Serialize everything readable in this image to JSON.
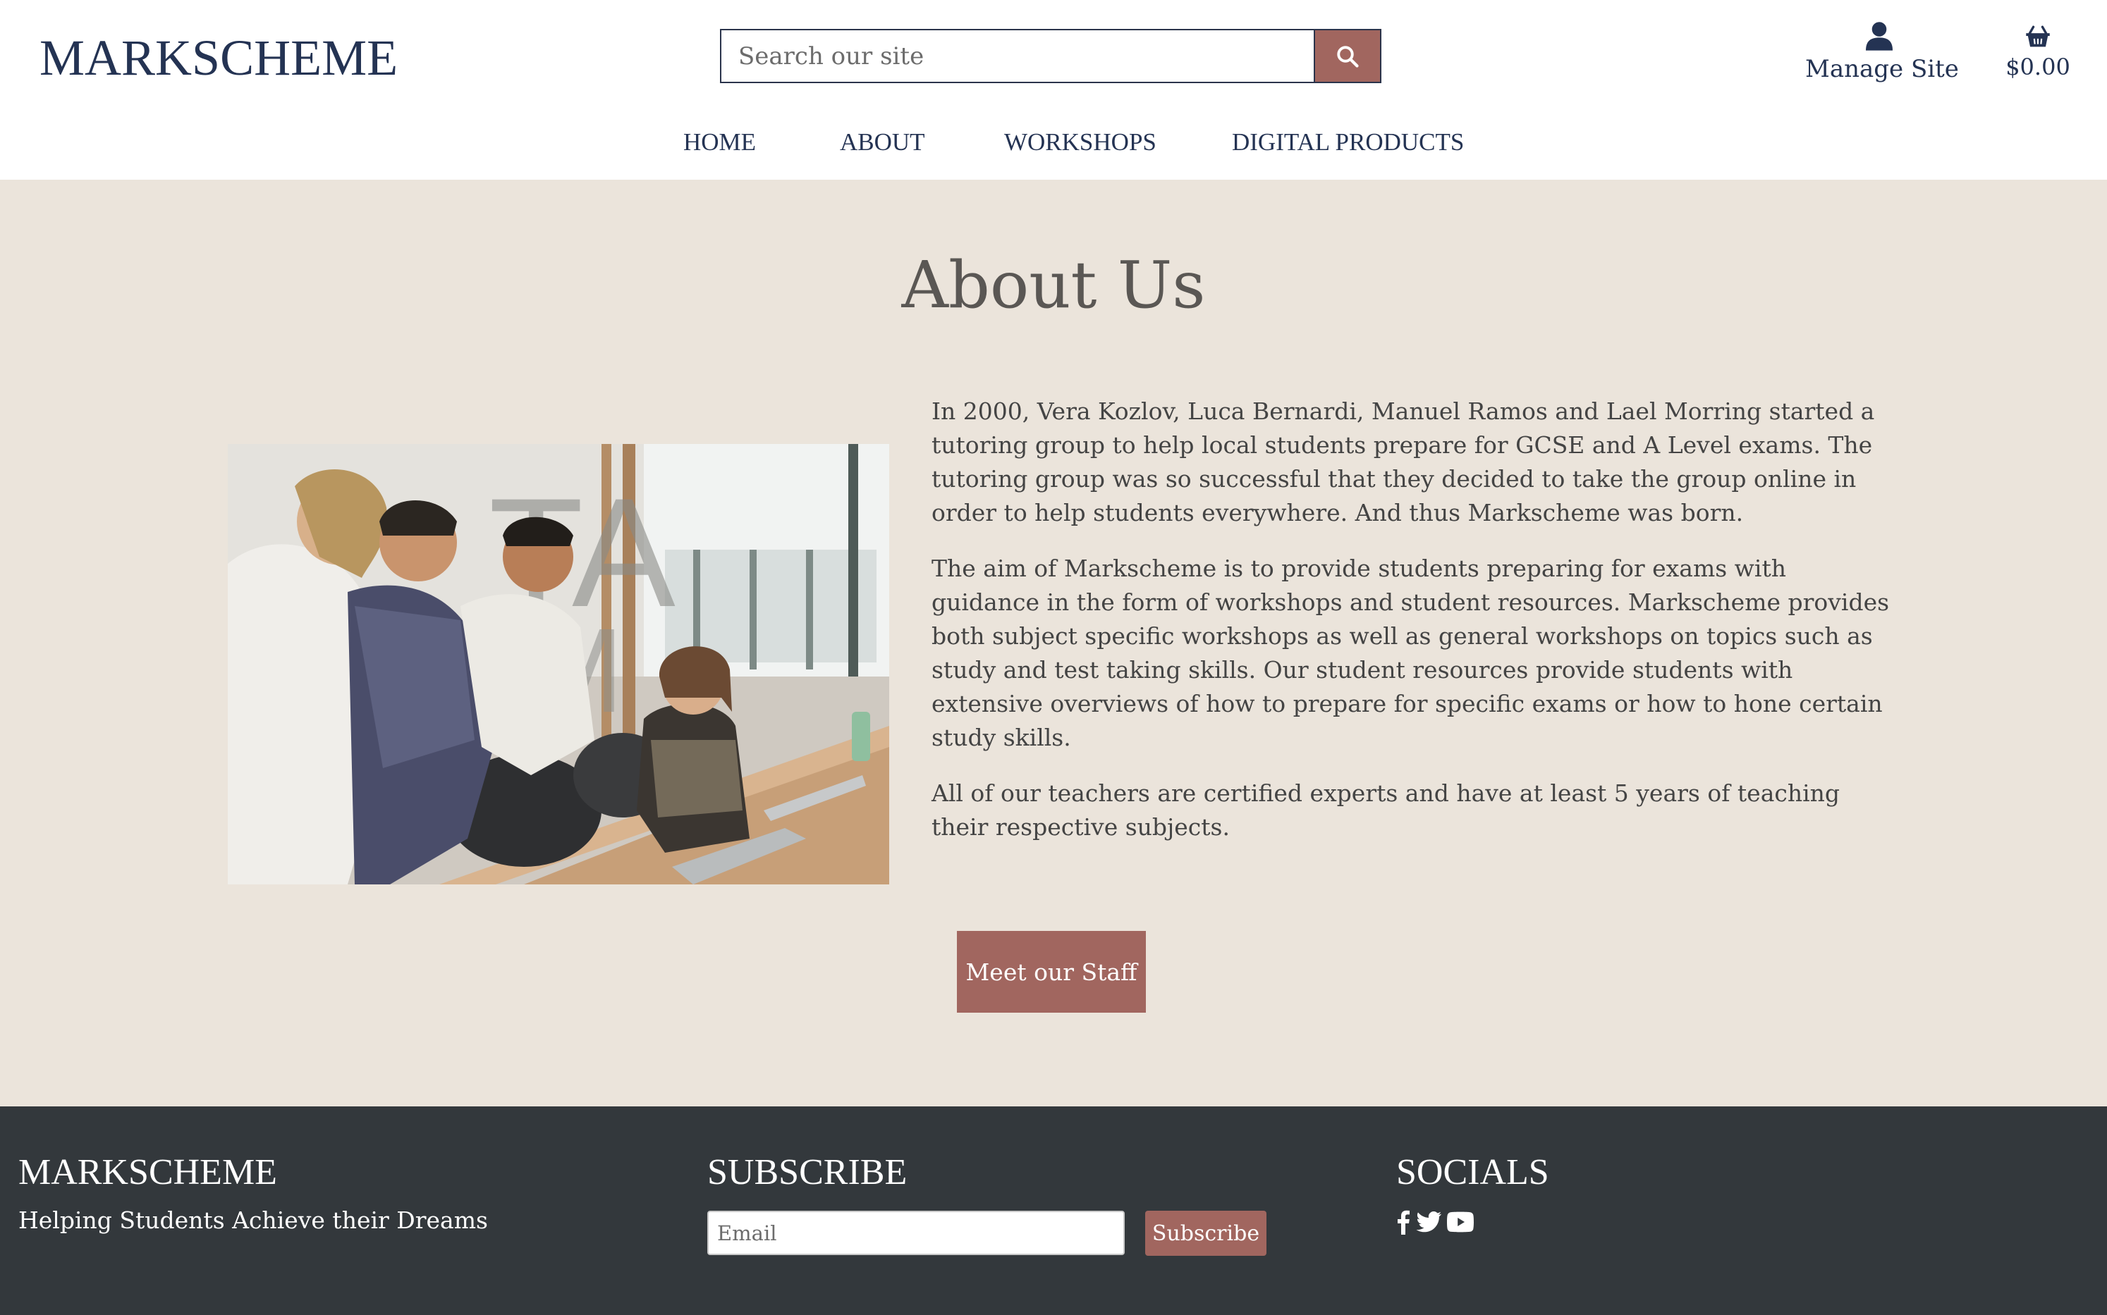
{
  "header": {
    "logo": "MARKSCHEME",
    "search": {
      "placeholder": "Search our site"
    },
    "icons": {
      "search": "search-icon",
      "user": "user-icon",
      "cart": "basket-icon"
    },
    "manage_site_label": "Manage Site",
    "cart_total": "$0.00"
  },
  "nav": {
    "items": [
      {
        "label": "HOME"
      },
      {
        "label": "ABOUT"
      },
      {
        "label": "WORKSHOPS"
      },
      {
        "label": "DIGITAL PRODUCTS"
      }
    ]
  },
  "main": {
    "title": "About Us",
    "photo": "team-collaboration-photo",
    "paragraphs": [
      "In 2000, Vera Kozlov, Luca Bernardi, Manuel Ramos and Lael Morring started a tutoring group to help local students prepare for GCSE and A Level exams. The tutoring group was so successful that they decided to take the group online in order to help students everywhere. And thus Markscheme was born.",
      "The aim of Markscheme is to provide students preparing for exams with guidance in the form of workshops and student resources. Markscheme provides both subject specific workshops as well as general workshops on topics such as study and test taking skills. Our student resources provide students with extensive overviews of how to prepare for specific exams or how to hone certain study skills.",
      "All of our teachers are certified experts and have at least 5 years of teaching their respective subjects."
    ],
    "cta_label": "Meet our Staff"
  },
  "footer": {
    "brand": "MARKSCHEME",
    "tagline": "Helping Students Achieve their Dreams",
    "subscribe_heading": "SUBSCRIBE",
    "email_placeholder": "Email",
    "subscribe_label": "Subscribe",
    "socials_heading": "SOCIALS",
    "social_icons": [
      "facebook-icon",
      "twitter-icon",
      "youtube-icon"
    ]
  },
  "colors": {
    "navy": "#243353",
    "accent": "#a1665f",
    "main_background": "#ebe4db",
    "footer_background": "#33383c",
    "header_background": "#ffffff"
  }
}
